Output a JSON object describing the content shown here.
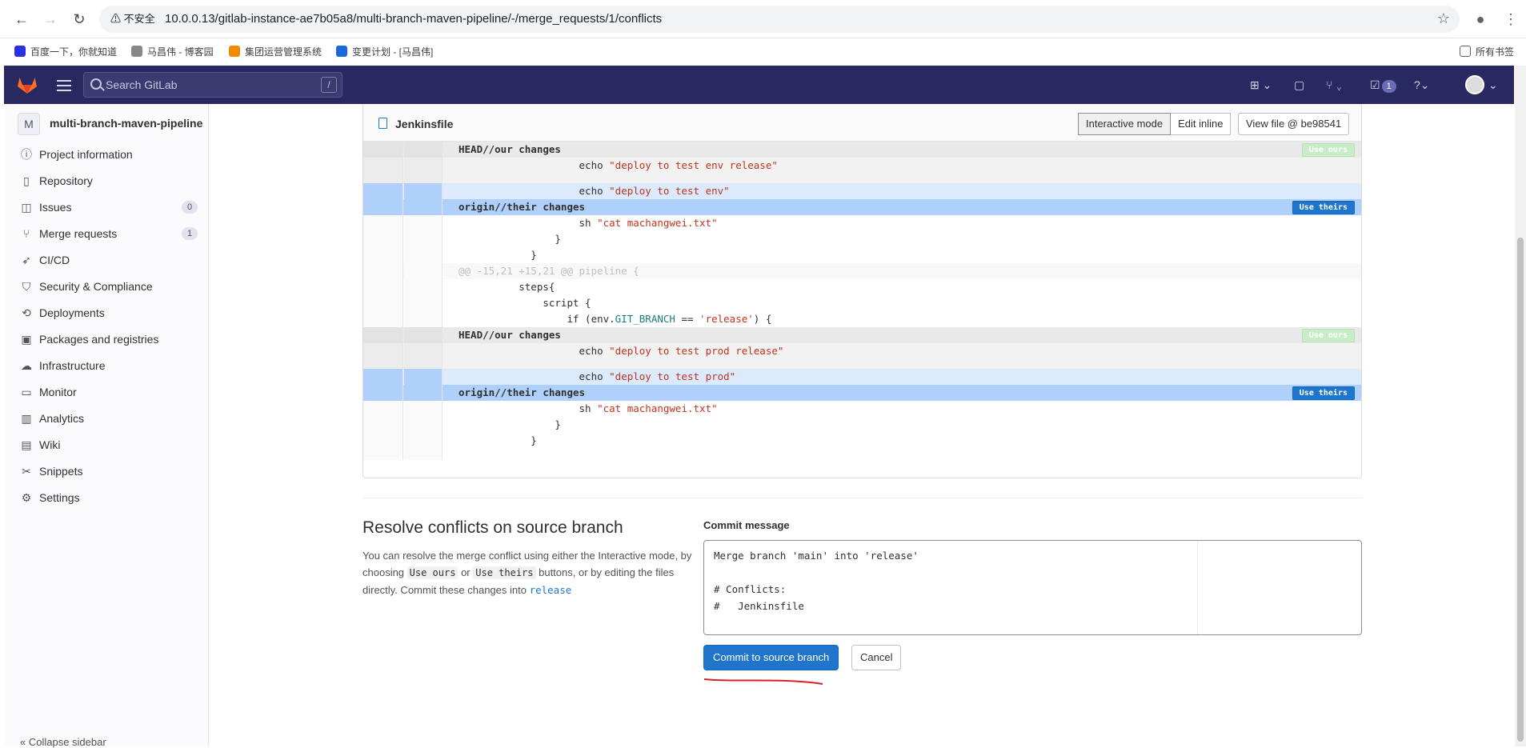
{
  "browser": {
    "insecure_label": "不安全",
    "url": "10.0.0.13/gitlab-instance-ae7b05a8/multi-branch-maven-pipeline/-/merge_requests/1/conflicts",
    "bookmarks": [
      "百度一下，你就知道",
      "马昌伟 - 博客园",
      "集团运营管理系统",
      "变更计划 - [马昌伟]"
    ],
    "all_bookmarks": "所有书签"
  },
  "header": {
    "search_placeholder": "Search GitLab",
    "search_shortcut": "/",
    "todos_count": "1"
  },
  "sidebar": {
    "project_initial": "M",
    "project_name": "multi-branch-maven-pipeline",
    "items": [
      {
        "label": "Project information",
        "icon": "info-icon"
      },
      {
        "label": "Repository",
        "icon": "file-icon"
      },
      {
        "label": "Issues",
        "icon": "issues-icon",
        "badge": "0"
      },
      {
        "label": "Merge requests",
        "icon": "merge-request-icon",
        "badge": "1"
      },
      {
        "label": "CI/CD",
        "icon": "rocket-icon"
      },
      {
        "label": "Security & Compliance",
        "icon": "shield-icon"
      },
      {
        "label": "Deployments",
        "icon": "deployments-icon"
      },
      {
        "label": "Packages and registries",
        "icon": "package-icon"
      },
      {
        "label": "Infrastructure",
        "icon": "cloud-icon"
      },
      {
        "label": "Monitor",
        "icon": "monitor-icon"
      },
      {
        "label": "Analytics",
        "icon": "chart-icon"
      },
      {
        "label": "Wiki",
        "icon": "book-icon"
      },
      {
        "label": "Snippets",
        "icon": "scissors-icon"
      },
      {
        "label": "Settings",
        "icon": "gear-icon"
      }
    ],
    "collapse_label": "Collapse sidebar"
  },
  "file": {
    "name": "Jenkinsfile",
    "interactive_mode": "Interactive mode",
    "edit_inline": "Edit inline",
    "view_file": "View file @ be98541",
    "use_ours": "Use ours",
    "use_theirs": "Use theirs",
    "lines": [
      {
        "kind": "head-ours",
        "text": "HEAD//our changes"
      },
      {
        "kind": "ours",
        "pre": "                    echo ",
        "str": "\"deploy to test env release\""
      },
      {
        "kind": "ours",
        "text": ""
      },
      {
        "kind": "theirs",
        "pre": "                    echo ",
        "str": "\"deploy to test env\""
      },
      {
        "kind": "head-theirs",
        "text": "origin//their changes"
      },
      {
        "kind": "normal",
        "pre": "                    sh ",
        "str": "\"cat machangwei.txt\""
      },
      {
        "kind": "normal",
        "text": "                }"
      },
      {
        "kind": "normal",
        "text": "            }"
      },
      {
        "kind": "hunk",
        "text": "@@ -15,21 +15,21 @@ pipeline {"
      },
      {
        "kind": "normal",
        "text": "          steps{"
      },
      {
        "kind": "normal",
        "text": "              script {"
      },
      {
        "kind": "normal",
        "pre": "                  if (env.",
        "kw": "GIT_BRANCH",
        "mid": " == ",
        "str": "'release'",
        "post": ") {"
      },
      {
        "kind": "head-ours",
        "text": "HEAD//our changes"
      },
      {
        "kind": "ours",
        "pre": "                    echo ",
        "str": "\"deploy to test prod release\""
      },
      {
        "kind": "ours",
        "text": ""
      },
      {
        "kind": "theirs",
        "pre": "                    echo ",
        "str": "\"deploy to test prod\""
      },
      {
        "kind": "head-theirs",
        "text": "origin//their changes"
      },
      {
        "kind": "normal",
        "pre": "                    sh ",
        "str": "\"cat machangwei.txt\""
      },
      {
        "kind": "normal",
        "text": "                }"
      },
      {
        "kind": "normal",
        "text": "            }"
      },
      {
        "kind": "normal",
        "text": ""
      }
    ]
  },
  "resolve": {
    "title": "Resolve conflicts on source branch",
    "desc_1": "You can resolve the merge conflict using either the Interactive mode, by choosing ",
    "use_ours_code": "Use ours",
    "desc_or": " or ",
    "use_theirs_code": "Use theirs",
    "desc_2": " buttons, or by editing the files directly. Commit these changes into ",
    "branch": "release",
    "commit_label": "Commit message",
    "commit_message": "Merge branch 'main' into 'release'\n\n# Conflicts:\n#   Jenkinsfile",
    "commit_button": "Commit to source branch",
    "cancel_button": "Cancel"
  }
}
